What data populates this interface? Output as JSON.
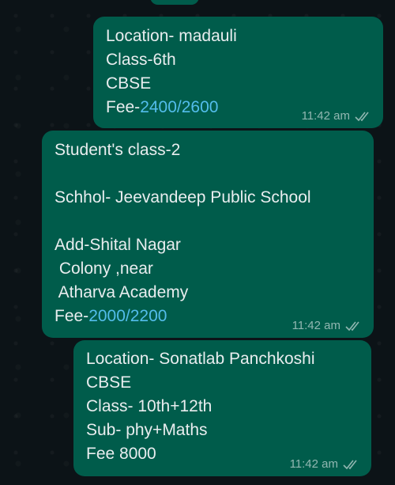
{
  "messages": [
    {
      "lines": [
        {
          "text": "Location- madauli"
        },
        {
          "text": "Class-6th"
        },
        {
          "text": "CBSE"
        },
        {
          "text": "Fee-",
          "link": "2400/2600"
        }
      ],
      "time": "11:42 am",
      "status_icon": "double-check-icon"
    },
    {
      "lines": [
        {
          "text": "Student's class-2"
        },
        {
          "text": ""
        },
        {
          "text": "Schhol- Jeevandeep Public School"
        },
        {
          "text": ""
        },
        {
          "text": "Add-Shital Nagar"
        },
        {
          "text": " Colony ,near"
        },
        {
          "text": " Atharva Academy"
        },
        {
          "text": "Fee-",
          "link": "2000/2200"
        }
      ],
      "time": "11:42 am",
      "status_icon": "double-check-icon"
    },
    {
      "lines": [
        {
          "text": "Location- Sonatlab Panchkoshi"
        },
        {
          "text": "CBSE"
        },
        {
          "text": "Class- 10th+12th"
        },
        {
          "text": "Sub- phy+Maths"
        },
        {
          "text": "Fee 8000"
        }
      ],
      "time": "11:42 am",
      "status_icon": "double-check-icon"
    }
  ],
  "colors": {
    "bubble_outgoing": "#005c4b",
    "link": "#53bdeb",
    "background": "#0b141a"
  }
}
